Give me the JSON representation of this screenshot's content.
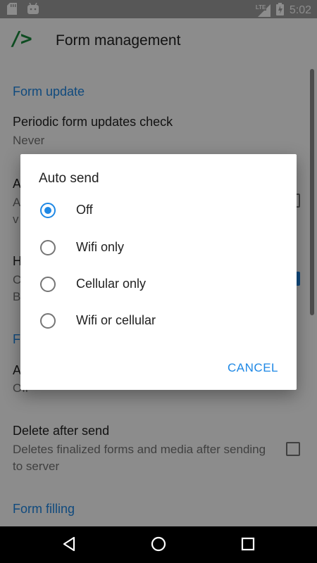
{
  "status": {
    "network": "LTE",
    "time": "5:02"
  },
  "appbar": {
    "logo_text": "/>",
    "title": "Form management"
  },
  "prefs": {
    "cat_form_update": "Form update",
    "periodic_title": "Periodic form updates check",
    "periodic_value": "Never",
    "hidden_title_1": "A",
    "hidden_sum_1a": "A",
    "hidden_sum_1b": "v",
    "hidden_title_2": "H",
    "hidden_sum_2a": "C",
    "hidden_sum_2b": "B",
    "cat_f": "F",
    "hidden_title_3": "A",
    "hidden_sum_3": "Off",
    "delete_title": "Delete after send",
    "delete_sum": "Deletes finalized forms and media after sending to server",
    "cat_form_filling": "Form filling"
  },
  "dialog": {
    "title": "Auto send",
    "options": [
      {
        "label": "Off",
        "checked": true
      },
      {
        "label": "Wifi only",
        "checked": false
      },
      {
        "label": "Cellular only",
        "checked": false
      },
      {
        "label": "Wifi or cellular",
        "checked": false
      }
    ],
    "cancel_label": "CANCEL"
  },
  "colors": {
    "accent": "#1e88e5",
    "logo": "#1b8a3d"
  },
  "icons": {
    "status_left": [
      "sd-card-icon",
      "android-icon"
    ],
    "status_right": [
      "signal-lte-icon",
      "battery-charging-icon"
    ],
    "nav": [
      "back-icon",
      "home-icon",
      "recents-icon"
    ]
  }
}
